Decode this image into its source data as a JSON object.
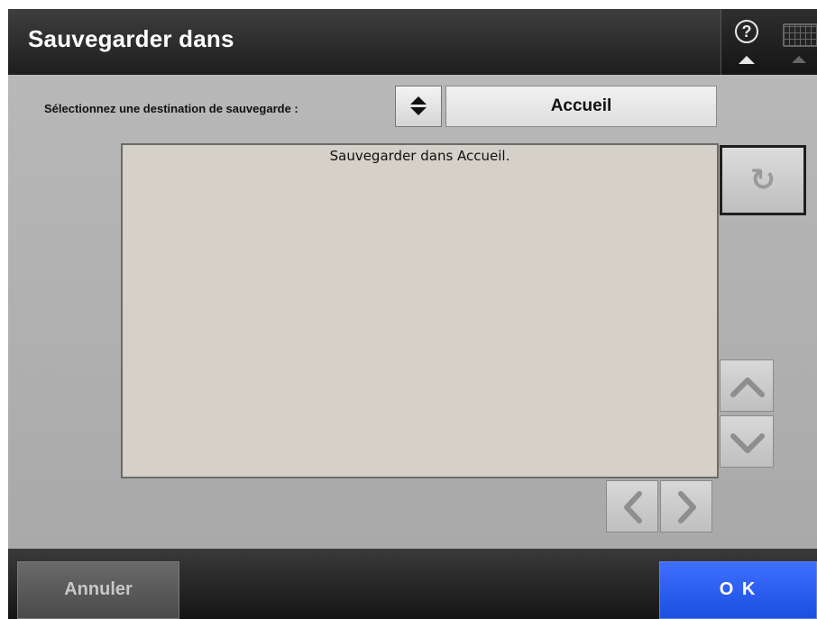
{
  "window": {
    "title": "Sauvegarder dans",
    "help_label": "?"
  },
  "destination": {
    "label": "Sélectionnez une destination de sauvegarde :",
    "selected": "Accueil"
  },
  "list": {
    "message": "Sauvegarder dans Accueil."
  },
  "footer": {
    "cancel_label": "Annuler",
    "ok_label": "O K"
  },
  "colors": {
    "ok_button": "#2b5cf5",
    "list_background": "#d5d0c8",
    "titlebar": "#2a2a2a"
  },
  "icons": {
    "help": "question-icon",
    "keyboard": "keyboard-icon",
    "refresh": "refresh-icon",
    "scroll_up": "chevron-up-icon",
    "scroll_down": "chevron-down-icon",
    "page_left": "chevron-left-icon",
    "page_right": "chevron-right-icon"
  }
}
